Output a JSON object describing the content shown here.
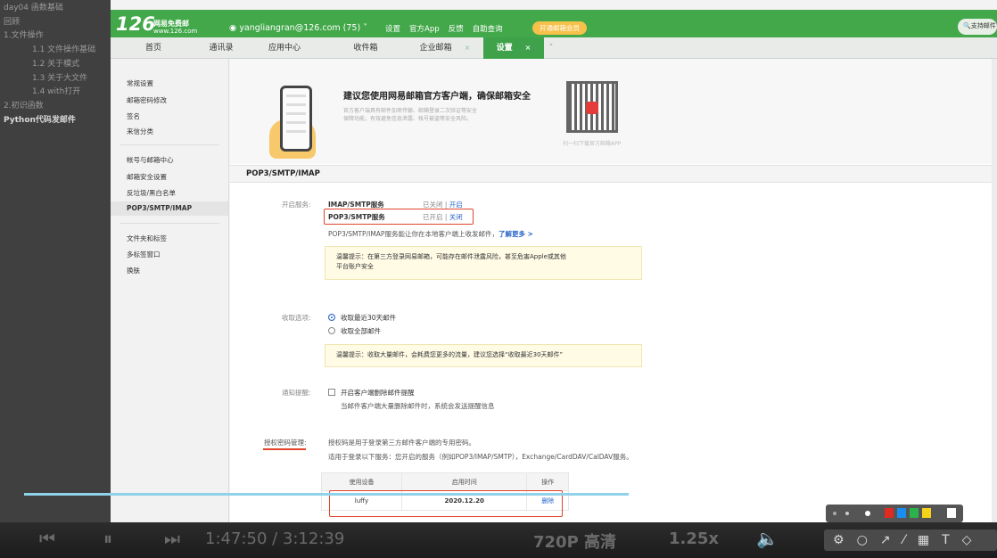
{
  "toc": {
    "items": [
      {
        "label": "day04 函数基础",
        "level": 1
      },
      {
        "label": "回顾",
        "level": 1
      },
      {
        "label": "1.文件操作",
        "level": 1
      },
      {
        "label": "1.1 文件操作基础",
        "level": 2
      },
      {
        "label": "1.2 关于模式",
        "level": 2
      },
      {
        "label": "1.3 关于大文件",
        "level": 2
      },
      {
        "label": "1.4 with打开",
        "level": 2
      },
      {
        "label": "2.初识函数",
        "level": 1
      },
      {
        "label": "Python代码发邮件",
        "level": 1,
        "bold": true
      }
    ]
  },
  "header": {
    "logo": "126",
    "logo_sub1": "网易免费邮",
    "logo_sub2": "www.126.com",
    "account": "yangliangran@126.com (75)",
    "nav": [
      "设置",
      "官方App",
      "反馈",
      "自助查询"
    ],
    "vip": "开通邮箱会员",
    "search": "支持邮件"
  },
  "tabs": [
    {
      "label": "首页"
    },
    {
      "label": "通讯录"
    },
    {
      "label": "应用中心"
    },
    {
      "label": "收件箱"
    },
    {
      "label": "企业邮箱"
    },
    {
      "label": "设置"
    }
  ],
  "leftnav": {
    "group1": [
      "常规设置",
      "邮箱密码修改",
      "签名",
      "来信分类"
    ],
    "group2": [
      "帐号与邮箱中心",
      "邮箱安全设置",
      "反垃圾/黑白名单",
      "POP3/SMTP/IMAP"
    ],
    "group3": [
      "文件夹和标签",
      "多标签窗口",
      "换肤"
    ]
  },
  "promo": {
    "title": "建议您使用网易邮箱官方客户端，确保邮箱安全",
    "sub1": "官方客户端具有邮件加密传输、邮箱登录二次验证等安全",
    "sub2": "保障功能，有效避免信息泄露、帐号被盗等安全风险。",
    "qr_caption": "扫一扫下载官方邮箱APP"
  },
  "section": {
    "title": "POP3/SMTP/IMAP",
    "service_label": "开启服务:",
    "imap_name": "IMAP/SMTP服务",
    "imap_status": "已关闭 | ",
    "imap_action": "开启",
    "pop_name": "POP3/SMTP服务",
    "pop_status": "已开启 | ",
    "pop_action": "关闭",
    "desc": "POP3/SMTP/IMAP服务能让你在本地客户端上收发邮件，",
    "learn_more": "了解更多 >",
    "tip1_a": "温馨提示：在第三方登录网易邮箱，可能存在邮件泄露风险，甚至危害Apple或其他",
    "tip1_b": "平台账户安全",
    "receive_label": "收取选项:",
    "receive_opt1": "收取最近30天邮件",
    "receive_opt2": "收取全部邮件",
    "tip2": "温馨提示：收取大量邮件，会耗费您更多的流量，建议您选择“收取最近30天邮件”",
    "notify_label": "通知提醒:",
    "notify_opt": "开启客户端删除邮件提醒",
    "notify_desc": "当邮件客户端大量删除邮件时，系统会发送提醒信息",
    "auth_label": "授权密码管理:",
    "auth_desc1": "授权码是用于登录第三方邮件客户端的专用密码。",
    "auth_desc2": "适用于登录以下服务：您开启的服务（例如POP3/IMAP/SMTP），Exchange/CardDAV/CalDAV服务。",
    "table_headers": [
      "使用设备",
      "启用时间",
      "操作"
    ],
    "table_row": {
      "device": "luffy",
      "time": "2020.12.20",
      "action": "删除"
    }
  },
  "player": {
    "time": "1:47:50 / 3:12:39",
    "quality": "720P 高清",
    "speed": "1.25x"
  },
  "annotation_colors": [
    "#e02b20",
    "#1a8ef0",
    "#2bb24c",
    "#f5d31a",
    "#555555",
    "#ffffff"
  ]
}
